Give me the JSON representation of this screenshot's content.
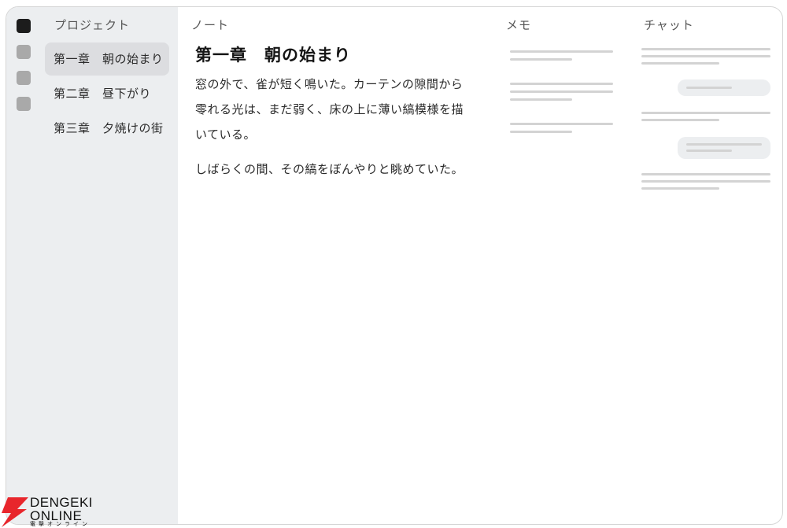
{
  "sidebar": {
    "title": "プロジェクト",
    "icons": [
      "app-icon",
      "tool-icon",
      "tool-icon",
      "tool-icon"
    ],
    "chapters": [
      {
        "label": "第一章　朝の始まり",
        "selected": true
      },
      {
        "label": "第二章　昼下がり",
        "selected": false
      },
      {
        "label": "第三章　夕焼けの街",
        "selected": false
      }
    ]
  },
  "note": {
    "header": "ノート",
    "title": "第一章　朝の始まり",
    "paragraphs": [
      "窓の外で、雀が短く鳴いた。カーテンの隙間から零れる光は、まだ弱く、床の上に薄い縞模様を描いている。",
      "しばらくの間、その縞をぼんやりと眺めていた。"
    ]
  },
  "memo": {
    "header": "メモ"
  },
  "chat": {
    "header": "チャット"
  },
  "watermark": {
    "line1": "DENGEKI",
    "line2": "ONLINE",
    "kana": "電撃オンライン",
    "accent_color": "#e8262c"
  }
}
